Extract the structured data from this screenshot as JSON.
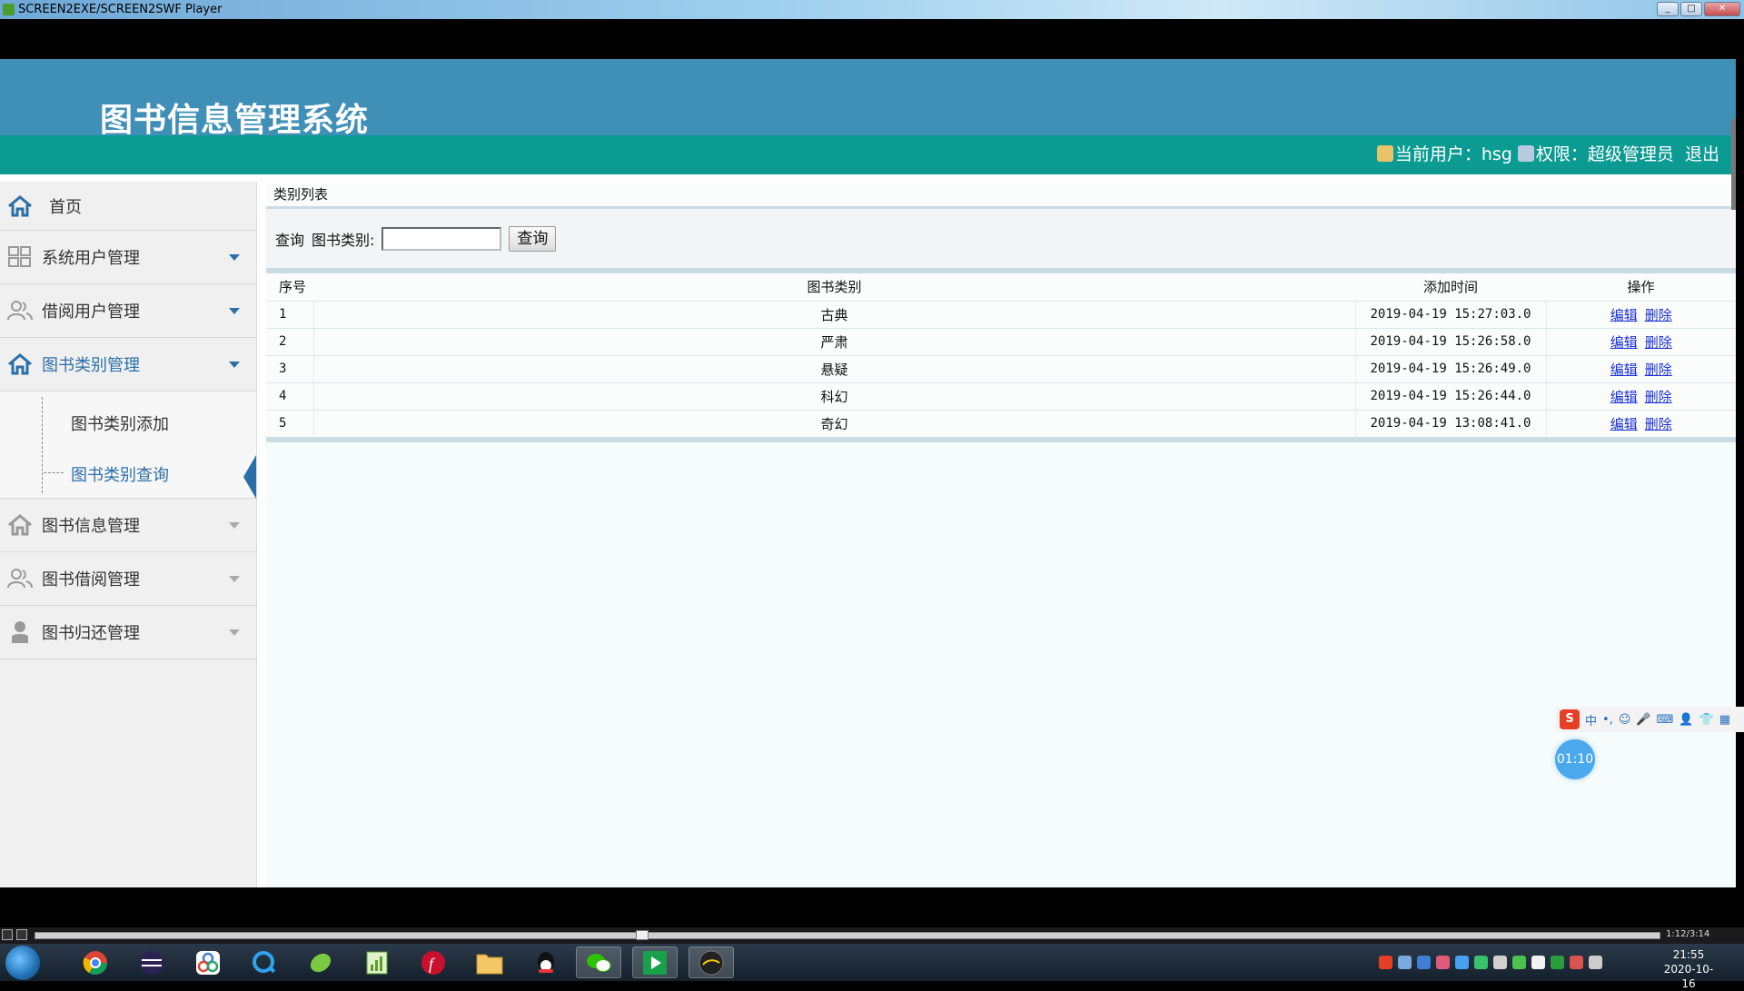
{
  "window": {
    "title": "SCREEN2EXE/SCREEN2SWF Player"
  },
  "header": {
    "title": "图书信息管理系统",
    "user_label": "当前用户：",
    "user_name": "hsg",
    "role_label": "权限：",
    "role": "超级管理员",
    "logout": "退出"
  },
  "sidebar": {
    "home": "首页",
    "items": [
      {
        "label": "系统用户管理",
        "icon": "grid-icon"
      },
      {
        "label": "借阅用户管理",
        "icon": "users-icon"
      },
      {
        "label": "图书类别管理",
        "icon": "home-icon"
      },
      {
        "label": "图书信息管理",
        "icon": "home-icon"
      },
      {
        "label": "图书借阅管理",
        "icon": "users-icon"
      },
      {
        "label": "图书归还管理",
        "icon": "user-icon"
      }
    ],
    "submenu": [
      "图书类别添加",
      "图书类别查询"
    ]
  },
  "content": {
    "breadcrumb": "类别列表",
    "query": {
      "label": "查询",
      "field_label": "图书类别:",
      "value": "",
      "button": "查询"
    },
    "table": {
      "headers": [
        "序号",
        "图书类别",
        "添加时间",
        "操作"
      ],
      "rows": [
        {
          "id": "1",
          "category": "古典",
          "time": "2019-04-19 15:27:03.0"
        },
        {
          "id": "2",
          "category": "严肃",
          "time": "2019-04-19 15:26:58.0"
        },
        {
          "id": "3",
          "category": "悬疑",
          "time": "2019-04-19 15:26:49.0"
        },
        {
          "id": "4",
          "category": "科幻",
          "time": "2019-04-19 15:26:44.0"
        },
        {
          "id": "5",
          "category": "奇幻",
          "time": "2019-04-19 13:08:41.0"
        }
      ],
      "edit_label": "编辑",
      "delete_label": "删除"
    }
  },
  "overlay": {
    "ime_label": "中",
    "timer": "01:10"
  },
  "player": {
    "time": "1:12/3:14"
  },
  "taskbar": {
    "clock_time": "21:55",
    "clock_date": "2020-10-16"
  },
  "colors": {
    "header": "#3f8fb6",
    "userbar": "#0c9b93",
    "link": "#1a2fd6",
    "accent": "#2b6fa8"
  }
}
